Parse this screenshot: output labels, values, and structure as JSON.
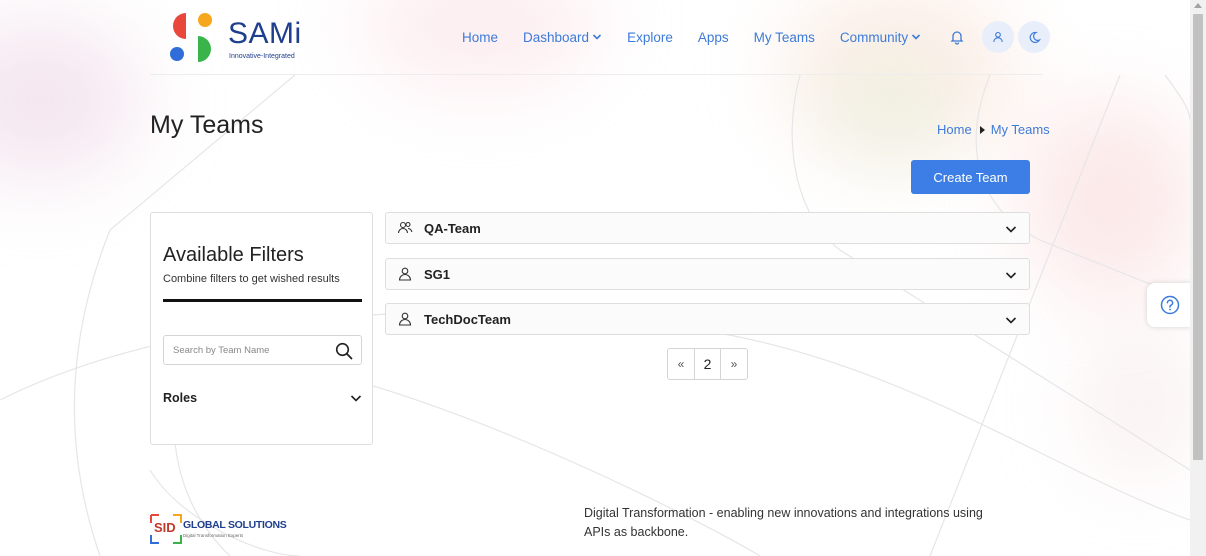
{
  "header": {
    "logo_text": "SAMi",
    "logo_subtext": "Innovative-Integrated",
    "nav": [
      {
        "label": "Home"
      },
      {
        "label": "Dashboard"
      },
      {
        "label": "Explore"
      },
      {
        "label": "Apps"
      },
      {
        "label": "My Teams"
      },
      {
        "label": "Community"
      }
    ]
  },
  "page": {
    "title": "My Teams",
    "breadcrumb": [
      "Home",
      "My Teams"
    ],
    "create_button": "Create Team"
  },
  "filters": {
    "title": "Available Filters",
    "subtitle": "Combine filters to get wished results",
    "search_placeholder": "Search by Team Name",
    "roles_label": "Roles"
  },
  "teams": [
    {
      "name": "QA-Team",
      "icon": "users-icon"
    },
    {
      "name": "SG1",
      "icon": "user-icon"
    },
    {
      "name": "TechDocTeam",
      "icon": "user-icon"
    }
  ],
  "pagination": {
    "prev": "«",
    "current": "2",
    "next": "»"
  },
  "footer": {
    "brand_mark": "SID",
    "brand_name": "GLOBAL SOLUTIONS",
    "brand_tagline": "Digital Transformation Experts",
    "tagline": "Digital Transformation - enabling new innovations and integrations using APIs as backbone."
  },
  "colors": {
    "accent": "#3c7ee6",
    "link": "#3d7bd9",
    "logo_blue": "#1f3f8e"
  }
}
